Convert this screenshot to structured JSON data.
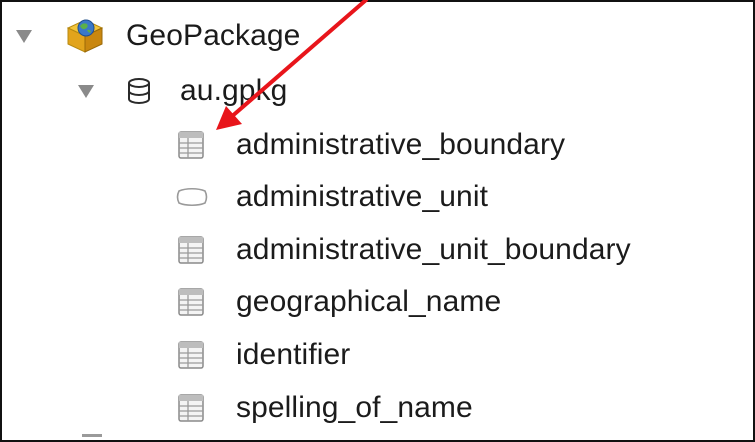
{
  "tree": {
    "root": {
      "label": "GeoPackage",
      "icon": "geopackage-provider-icon",
      "expanded": true
    },
    "file": {
      "label": "au.gpkg",
      "icon": "database-icon",
      "expanded": true
    },
    "layers": [
      {
        "label": "administrative_boundary",
        "icon": "table-icon"
      },
      {
        "label": "administrative_unit",
        "icon": "polygon-layer-icon"
      },
      {
        "label": "administrative_unit_boundary",
        "icon": "table-icon"
      },
      {
        "label": "geographical_name",
        "icon": "table-icon"
      },
      {
        "label": "identifier",
        "icon": "table-icon"
      },
      {
        "label": "spelling_of_name",
        "icon": "table-icon"
      }
    ]
  },
  "annotation": {
    "type": "arrow",
    "color": "#e8151b"
  }
}
